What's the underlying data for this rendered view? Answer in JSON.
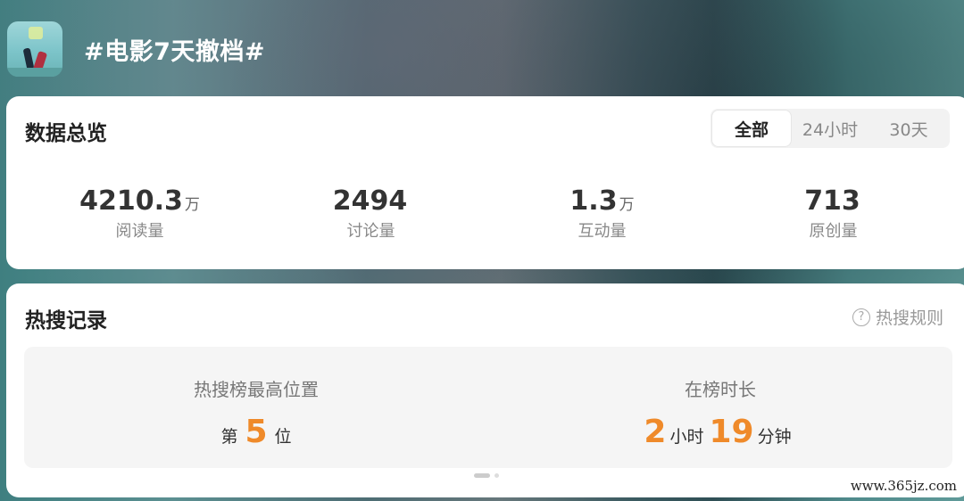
{
  "header": {
    "topic_title": "#电影7天撤档#"
  },
  "overview": {
    "title": "数据总览",
    "tabs": [
      {
        "label": "全部",
        "active": true
      },
      {
        "label": "24小时",
        "active": false
      },
      {
        "label": "30天",
        "active": false
      }
    ],
    "stats": [
      {
        "value": "4210.3",
        "unit": "万",
        "label": "阅读量"
      },
      {
        "value": "2494",
        "unit": "",
        "label": "讨论量"
      },
      {
        "value": "1.3",
        "unit": "万",
        "label": "互动量"
      },
      {
        "value": "713",
        "unit": "",
        "label": "原创量"
      }
    ]
  },
  "hot": {
    "title": "热搜记录",
    "rules_label": "热搜规则",
    "rules_icon": "?",
    "highest_position": {
      "label": "热搜榜最高位置",
      "prefix": "第",
      "value": "5",
      "suffix": "位"
    },
    "duration": {
      "label": "在榜时长",
      "hours": "2",
      "hours_unit": "小时",
      "minutes": "19",
      "minutes_unit": "分钟"
    }
  },
  "colors": {
    "accent": "#ef8a2a"
  },
  "watermark": "www.365jz.com"
}
